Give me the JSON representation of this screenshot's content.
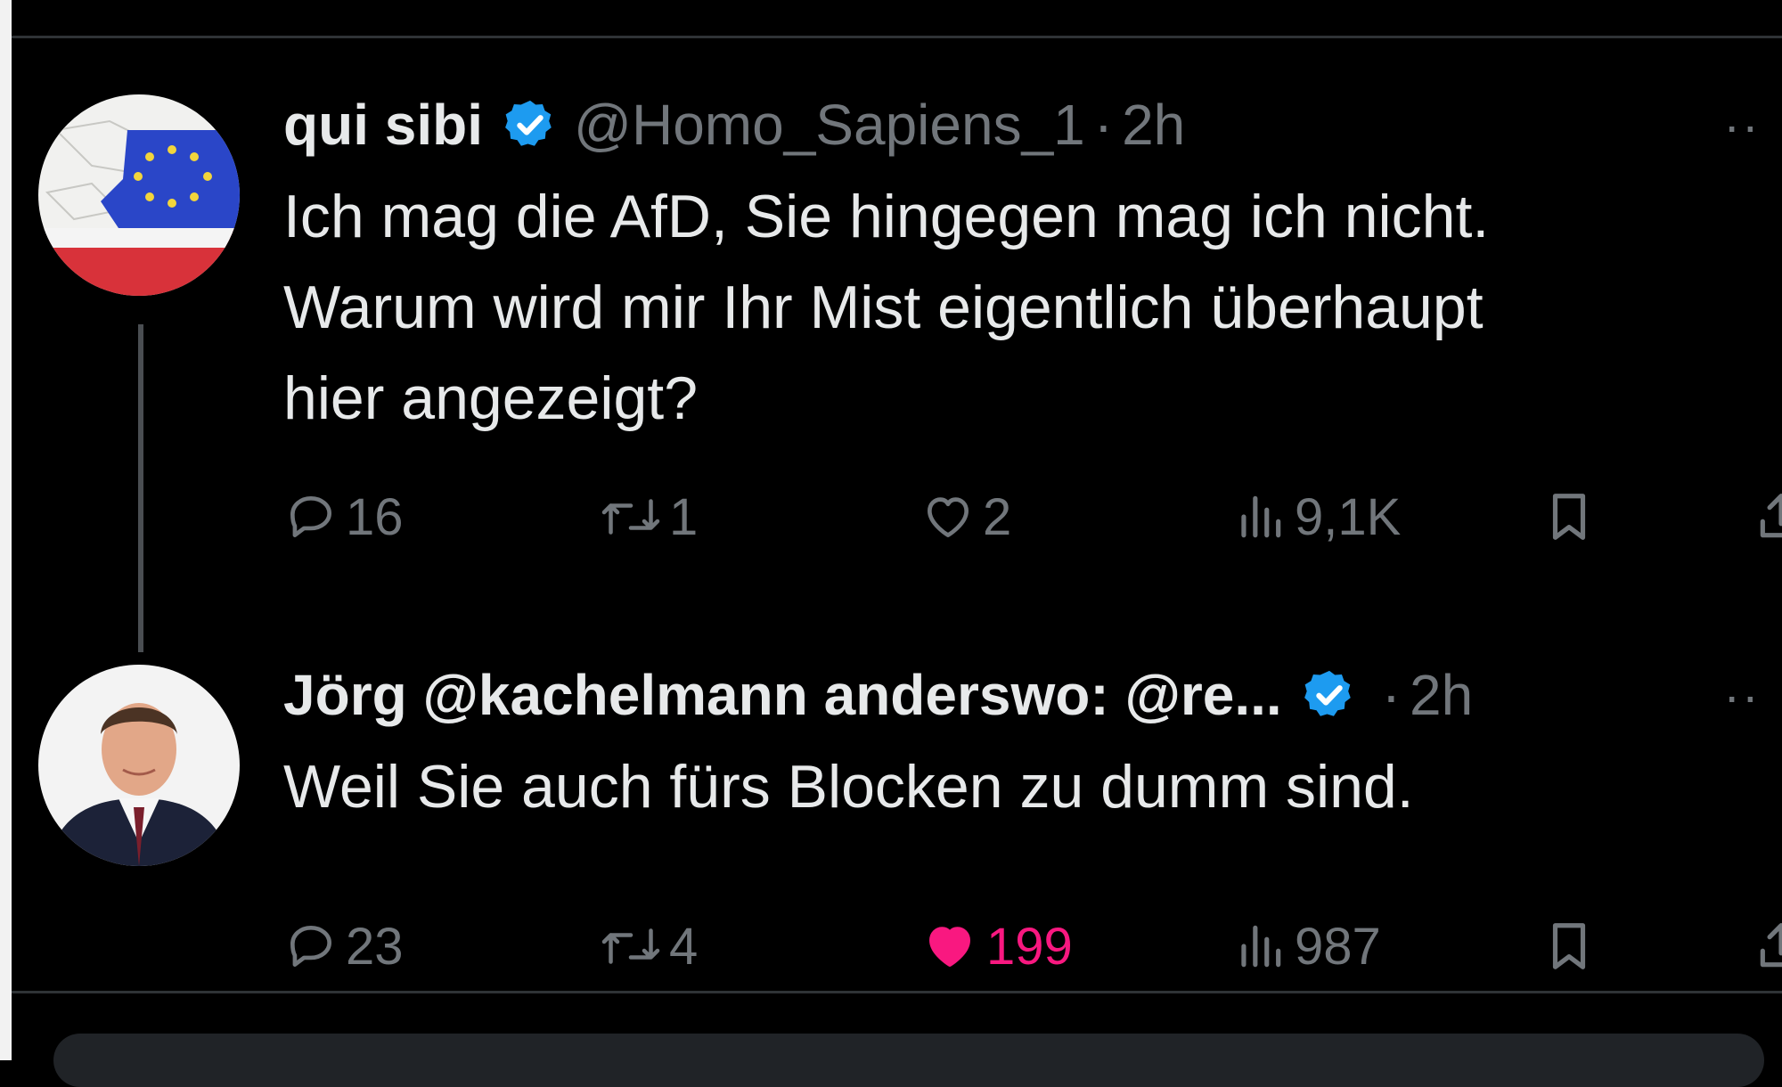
{
  "tweets": [
    {
      "name": "qui sibi",
      "handle": "@Homo_Sapiens_1",
      "separator": "·",
      "time": "2h",
      "text_lines": [
        "Ich mag die AfD, Sie hingegen mag ich nicht.",
        "Warum wird mir Ihr Mist eigentlich überhaupt",
        "hier angezeigt?"
      ],
      "verified": true,
      "avatar": "eu-russia-flag-map-avatar",
      "stats": {
        "replies": "16",
        "reposts": "1",
        "likes": "2",
        "views": "9,1K"
      },
      "liked": false
    },
    {
      "name": "Jörg @kachelmann anderswo: @re...",
      "handle": "",
      "separator": "·",
      "time": "2h",
      "text_lines": [
        "Weil Sie auch fürs Blocken zu dumm sind."
      ],
      "verified": true,
      "avatar": "man-in-suit-portrait-avatar",
      "stats": {
        "replies": "23",
        "reposts": "4",
        "likes": "199",
        "views": "987"
      },
      "liked": true
    }
  ],
  "colors": {
    "background": "#000000",
    "text_primary": "#e7e9ea",
    "text_secondary": "#71767b",
    "verified_blue": "#1d9bf0",
    "like_pink": "#f91880",
    "divider": "#2f3336"
  },
  "icons": {
    "more": "more-icon",
    "reply": "reply-bubble-icon",
    "repost": "repost-icon",
    "like": "heart-icon",
    "views": "bar-chart-icon",
    "bookmark": "bookmark-icon",
    "share": "share-icon",
    "verified": "verified-badge-icon"
  },
  "more_glyph": "··"
}
